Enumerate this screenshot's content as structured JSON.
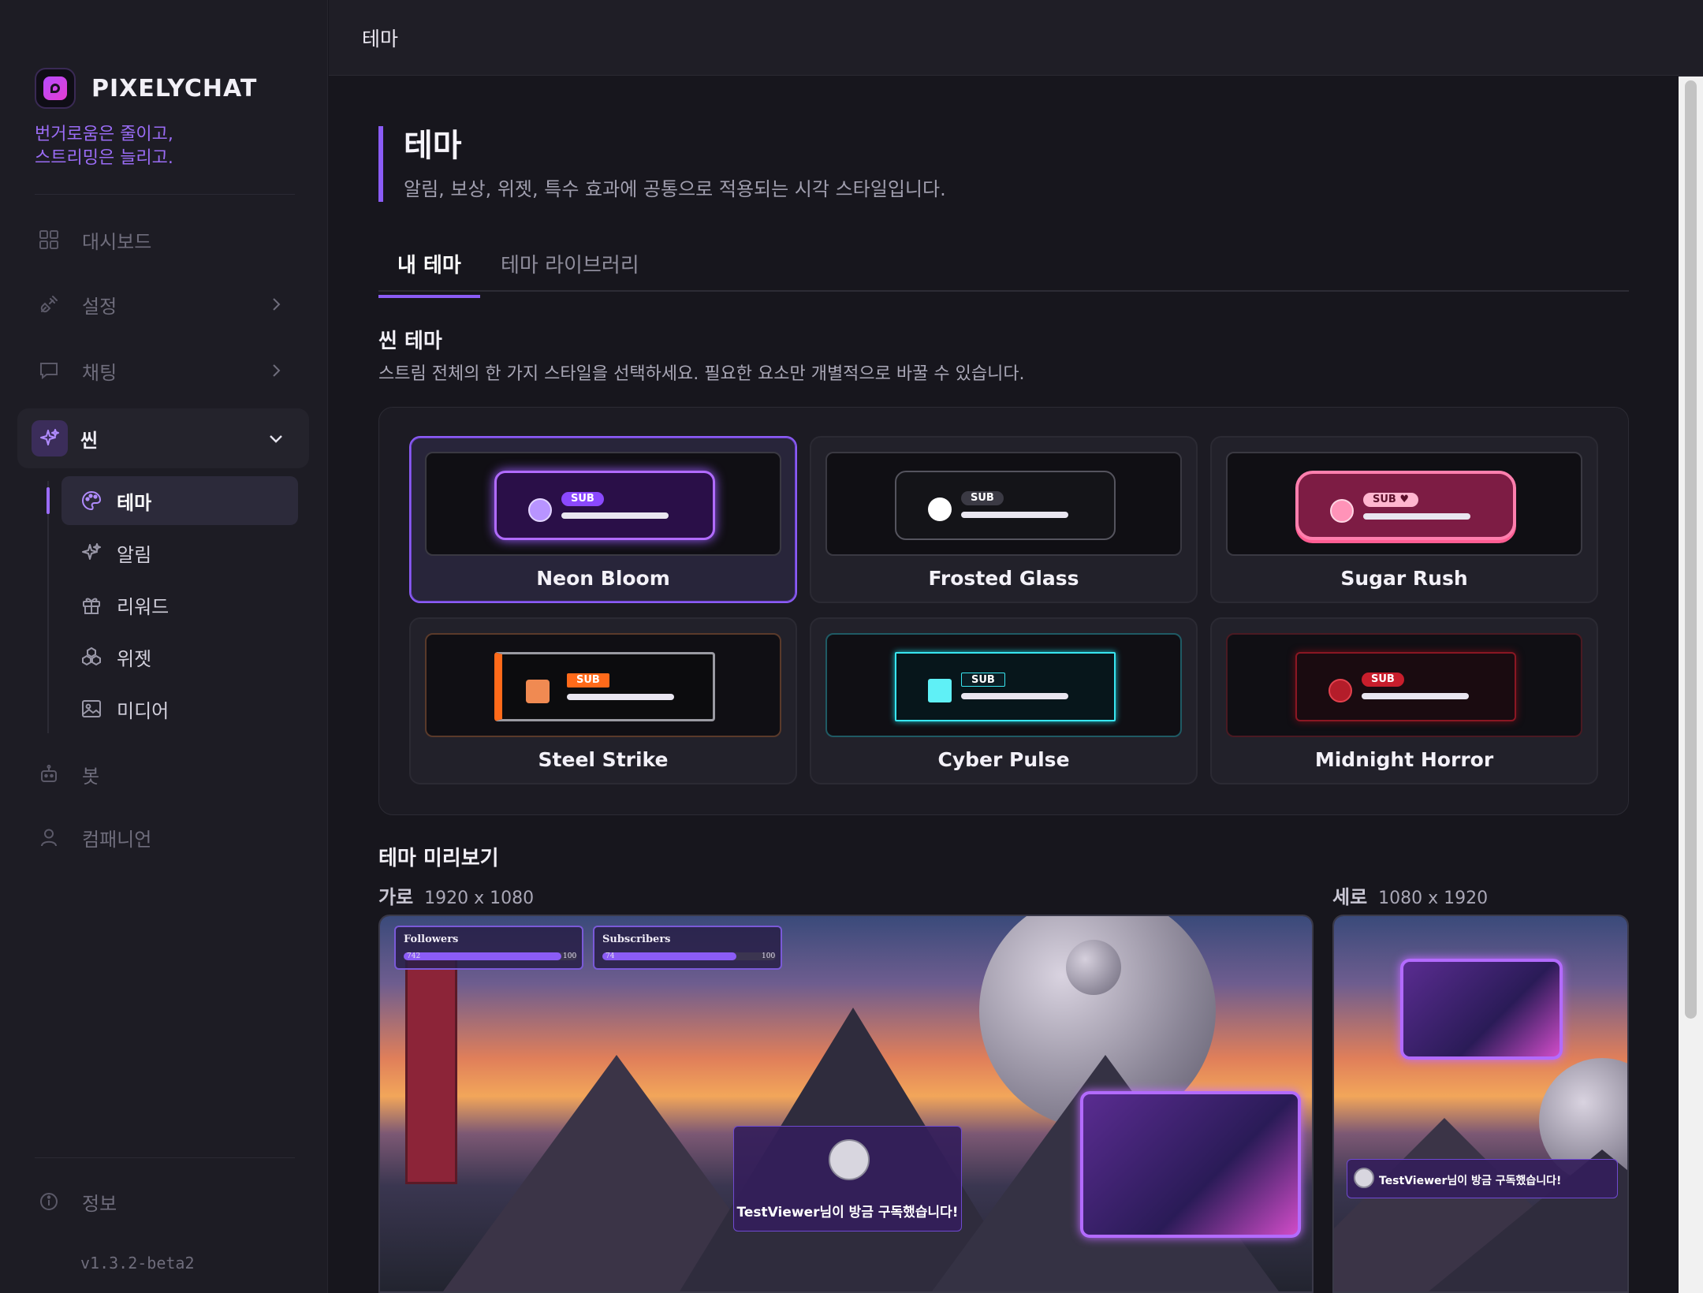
{
  "brand": {
    "name": "PIXELYCHAT",
    "tagline_line1": "번거로움은 줄이고,",
    "tagline_line2": "스트리밍은 늘리고."
  },
  "sidebar": {
    "items": [
      {
        "label": "대시보드",
        "icon": "grid-icon"
      },
      {
        "label": "설정",
        "icon": "plug-icon"
      },
      {
        "label": "채팅",
        "icon": "chat-bubble-icon"
      },
      {
        "label": "씬",
        "icon": "sparkle-icon"
      },
      {
        "label": "봇",
        "icon": "robot-icon"
      },
      {
        "label": "컴패니언",
        "icon": "person-icon"
      },
      {
        "label": "정보",
        "icon": "info-icon"
      }
    ],
    "sub_items": [
      {
        "label": "테마",
        "icon": "palette-icon"
      },
      {
        "label": "알림",
        "icon": "sparkle-icon"
      },
      {
        "label": "리워드",
        "icon": "gift-icon"
      },
      {
        "label": "위젯",
        "icon": "widget-icon"
      },
      {
        "label": "미디어",
        "icon": "image-icon"
      }
    ],
    "version": "v1.3.2-beta2"
  },
  "topbar": {
    "title": "테마"
  },
  "page": {
    "title": "테마",
    "subtitle": "알림, 보상, 위젯, 특수 효과에 공통으로 적용되는 시각 스타일입니다.",
    "tabs": [
      {
        "label": "내 테마"
      },
      {
        "label": "테마 라이브러리"
      }
    ]
  },
  "scene_themes": {
    "title": "씬 테마",
    "description": "스트림 전체의 한 가지 스타일을 선택하세요. 필요한 요소만 개별적으로 바꿀 수 있습니다.",
    "selected": "Neon Bloom",
    "cards": [
      {
        "name": "Neon Bloom",
        "badge": "SUB",
        "accent": "#a56bff"
      },
      {
        "name": "Frosted Glass",
        "badge": "SUB",
        "accent": "#e8e8ee"
      },
      {
        "name": "Sugar Rush",
        "badge": "SUB ♥",
        "accent": "#ff6f9e"
      },
      {
        "name": "Steel Strike",
        "badge": "SUB",
        "accent": "#ff6a1a"
      },
      {
        "name": "Cyber Pulse",
        "badge": "SUB",
        "accent": "#38e6f0"
      },
      {
        "name": "Midnight Horror",
        "badge": "SUB",
        "accent": "#d11f2c"
      }
    ]
  },
  "preview": {
    "title": "테마 미리보기",
    "landscape": {
      "label": "가로",
      "size": "1920 x 1080"
    },
    "portrait": {
      "label": "세로",
      "size": "1080 x 1920"
    },
    "hud": [
      {
        "label": "Followers",
        "current": "742",
        "max": "100"
      },
      {
        "label": "Subscribers",
        "current": "74",
        "max": "100"
      }
    ],
    "alert_text": "TestViewer님이 방금 구독했습니다!"
  }
}
